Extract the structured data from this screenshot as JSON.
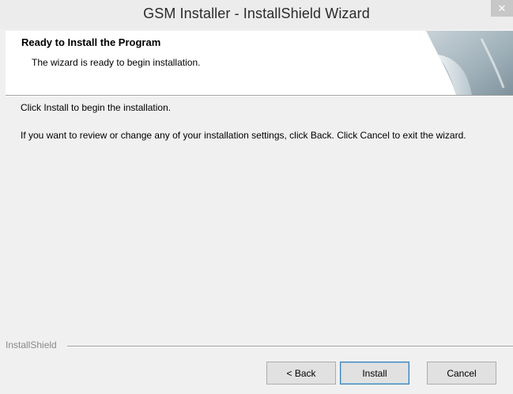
{
  "window": {
    "title": "GSM Installer - InstallShield Wizard",
    "close_glyph": "✕"
  },
  "header": {
    "title": "Ready to Install the Program",
    "subtitle": "The wizard is ready to begin installation."
  },
  "body": {
    "line1": "Click Install to begin the installation.",
    "line2": "If you want to review or change any of your installation settings, click Back. Click Cancel to exit the wizard."
  },
  "footer": {
    "brand": "InstallShield",
    "buttons": {
      "back": "< Back",
      "install": "Install",
      "cancel": "Cancel"
    }
  },
  "icons": {
    "header_graphic": "page-curl-icon",
    "close": "close-icon"
  }
}
